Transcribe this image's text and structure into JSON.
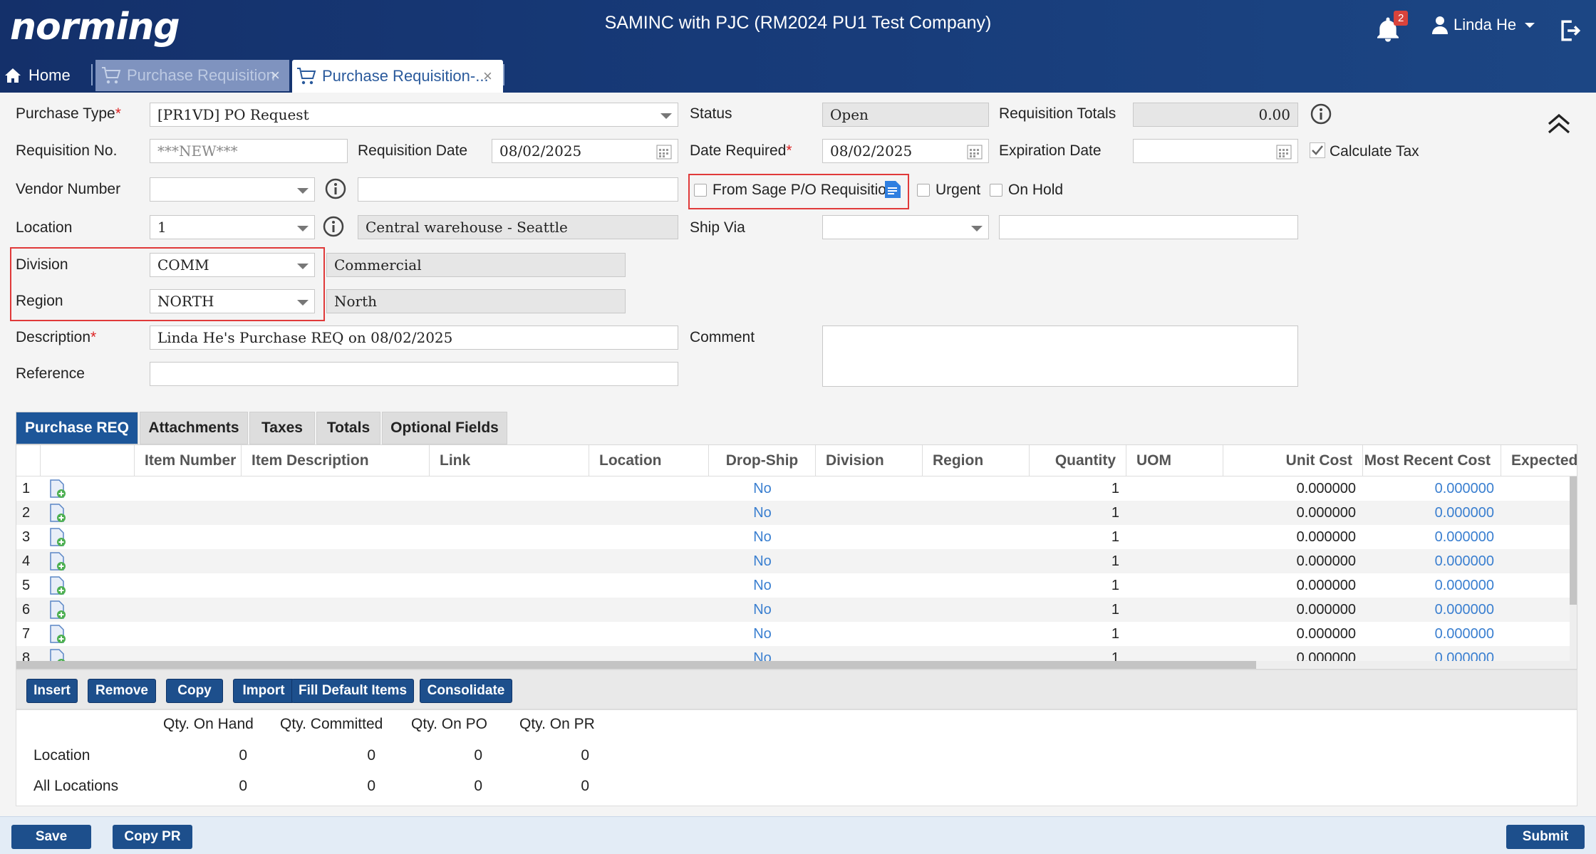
{
  "header": {
    "logo": "norming",
    "company": "SAMINC with PJC (RM2024 PU1 Test Company)",
    "notification_count": "2",
    "user": "Linda He"
  },
  "tabs": {
    "home": "Home",
    "tab1": "Purchase Requisition",
    "tab2": "Purchase Requisition-..."
  },
  "form": {
    "purchase_type_label": "Purchase Type",
    "purchase_type": "[PR1VD] PO Request",
    "status_label": "Status",
    "status": "Open",
    "req_totals_label": "Requisition Totals",
    "req_totals": "0.00",
    "req_no_label": "Requisition No.",
    "req_no": "***NEW***",
    "req_date_label": "Requisition Date",
    "req_date": "08/02/2025",
    "date_required_label": "Date Required",
    "date_required": "08/02/2025",
    "expiration_label": "Expiration Date",
    "expiration": "",
    "calc_tax_label": "Calculate Tax",
    "vendor_label": "Vendor Number",
    "vendor": "",
    "vendor_name": "",
    "from_sage_label": "From Sage P/O Requisition",
    "urgent_label": "Urgent",
    "onhold_label": "On Hold",
    "location_label": "Location",
    "location": "1",
    "location_name": "Central warehouse - Seattle",
    "ship_via_label": "Ship Via",
    "ship_via": "",
    "ship_via_name": "",
    "division_label": "Division",
    "division": "COMM",
    "division_name": "Commercial",
    "region_label": "Region",
    "region": "NORTH",
    "region_name": "North",
    "description_label": "Description",
    "description": "Linda He's Purchase REQ on 08/02/2025",
    "comment_label": "Comment",
    "comment": "",
    "reference_label": "Reference",
    "reference": ""
  },
  "detail_tabs": [
    "Purchase REQ",
    "Attachments",
    "Taxes",
    "Totals",
    "Optional Fields"
  ],
  "grid": {
    "columns": [
      "Item Number",
      "Item Description",
      "Link",
      "Location",
      "Drop-Ship",
      "Division",
      "Region",
      "Quantity",
      "UOM",
      "Unit Cost",
      "Most Recent Cost",
      "Expected"
    ],
    "rows": [
      {
        "n": "1",
        "drop": "No",
        "qty": "1",
        "unit": "0.000000",
        "recent": "0.000000"
      },
      {
        "n": "2",
        "drop": "No",
        "qty": "1",
        "unit": "0.000000",
        "recent": "0.000000"
      },
      {
        "n": "3",
        "drop": "No",
        "qty": "1",
        "unit": "0.000000",
        "recent": "0.000000"
      },
      {
        "n": "4",
        "drop": "No",
        "qty": "1",
        "unit": "0.000000",
        "recent": "0.000000"
      },
      {
        "n": "5",
        "drop": "No",
        "qty": "1",
        "unit": "0.000000",
        "recent": "0.000000"
      },
      {
        "n": "6",
        "drop": "No",
        "qty": "1",
        "unit": "0.000000",
        "recent": "0.000000"
      },
      {
        "n": "7",
        "drop": "No",
        "qty": "1",
        "unit": "0.000000",
        "recent": "0.000000"
      },
      {
        "n": "8",
        "drop": "No",
        "qty": "1",
        "unit": "0.000000",
        "recent": "0.000000"
      }
    ]
  },
  "grid_buttons": [
    "Insert",
    "Remove",
    "Copy",
    "Import",
    "Fill Default Items",
    "Consolidate"
  ],
  "summary": {
    "headers": [
      "Qty. On Hand",
      "Qty. Committed",
      "Qty. On PO",
      "Qty. On PR"
    ],
    "rows": [
      {
        "label": "Location",
        "vals": [
          "0",
          "0",
          "0",
          "0"
        ]
      },
      {
        "label": "All Locations",
        "vals": [
          "0",
          "0",
          "0",
          "0"
        ]
      }
    ]
  },
  "footer": {
    "save": "Save",
    "copy_pr": "Copy PR",
    "submit": "Submit"
  }
}
